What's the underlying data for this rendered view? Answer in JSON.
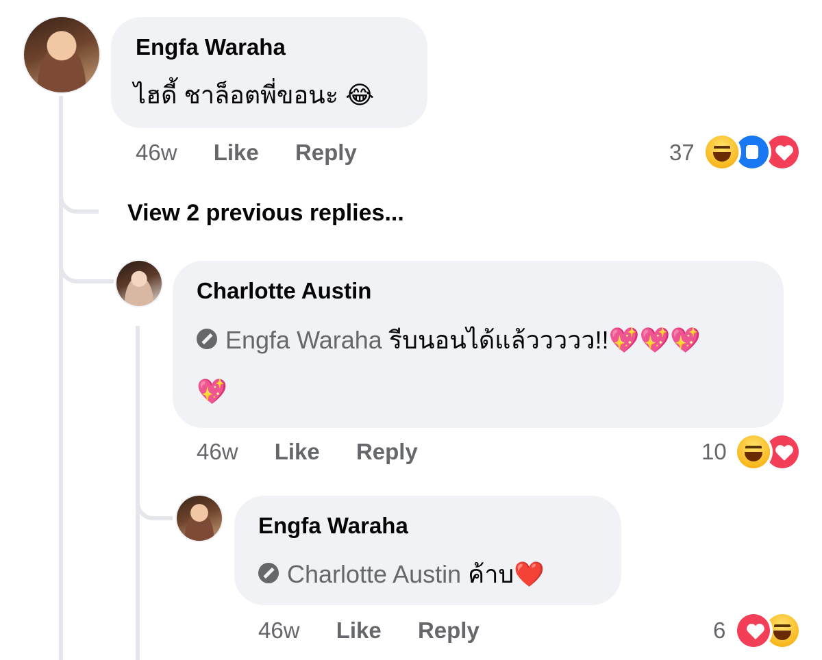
{
  "comment1": {
    "author": "Engfa Waraha",
    "text": "ไฮดี้ ชาล็อตพี่ขอนะ 😂",
    "time": "46w",
    "like_label": "Like",
    "reply_label": "Reply",
    "reaction_count": "37",
    "reactions": [
      "haha",
      "like",
      "love"
    ]
  },
  "view_previous_replies": "View 2 previous replies...",
  "reply1": {
    "author": "Charlotte Austin",
    "tag": "Engfa Waraha",
    "text_line1": " รีบนอนได้แล้ววววว!!💖💖💖",
    "text_line2": "💖",
    "time": "46w",
    "like_label": "Like",
    "reply_label": "Reply",
    "reaction_count": "10",
    "reactions": [
      "haha",
      "love"
    ]
  },
  "reply2": {
    "author": "Engfa Waraha",
    "tag": "Charlotte Austin",
    "text": " ค้าบ❤️",
    "time": "46w",
    "like_label": "Like",
    "reply_label": "Reply",
    "reaction_count": "6",
    "reactions": [
      "love",
      "haha"
    ]
  }
}
